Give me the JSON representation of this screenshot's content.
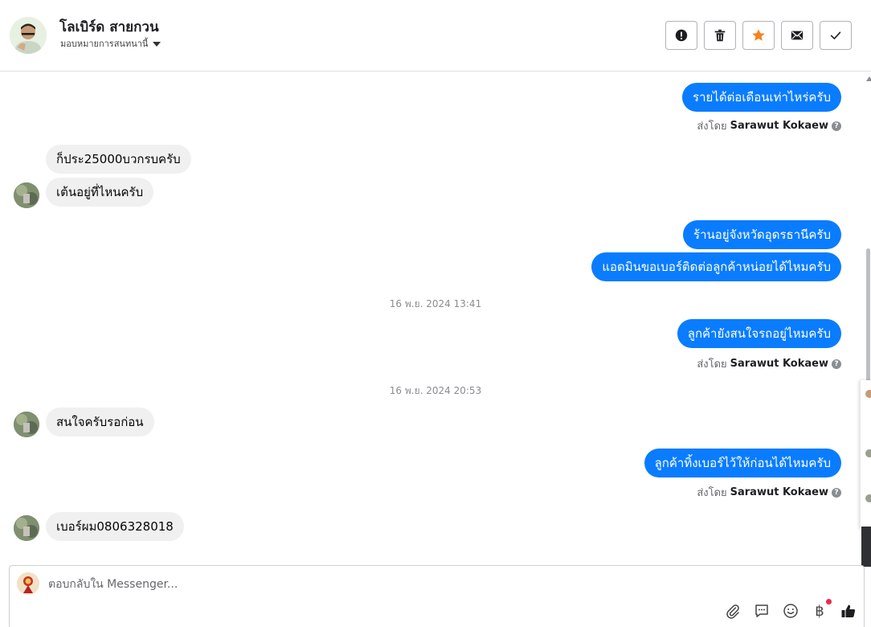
{
  "header": {
    "contact_name": "โลเบิร์ด สายกวน",
    "assign_label": "มอบหมายการสนทนานี้",
    "actions": [
      {
        "name": "spam-button",
        "icon": "alert-circle-icon"
      },
      {
        "name": "delete-button",
        "icon": "trash-icon"
      },
      {
        "name": "star-button",
        "icon": "star-icon"
      },
      {
        "name": "mark-unread-button",
        "icon": "envelope-icon"
      },
      {
        "name": "mark-done-button",
        "icon": "check-icon"
      }
    ]
  },
  "messages": {
    "m1": "รายได้ต่อเดือนเท่าไหร่ครับ",
    "m2": "ก็ประ25000บวกรบครับ",
    "m3": "เต้นอยู่ที่ไหนครับ",
    "m4": "ร้านอยู่จังหวัดอุดรธานีครับ",
    "m5": "แอดมินขอเบอร์ติดต่อลูกค้าหน่อยได้ไหมครับ",
    "m6": "ลูกค้ายังสนใจรถอยู่ไหมครับ",
    "m7": "สนใจครับรอก่อน",
    "m8": "ลูกค้าทิ้งเบอร์ไว้ให้ก่อนได้ไหมครับ",
    "m9": "เบอร์ผม0806328018",
    "sent_by_prefix": "ส่งโดย",
    "sent_by_name": "Sarawut Kokaew",
    "ts1": "16 พ.ย. 2024 13:41",
    "ts2": "16 พ.ย. 2024 20:53"
  },
  "composer": {
    "placeholder": "ตอบกลับใน Messenger...",
    "tools": [
      "attach-icon",
      "saved-reply-icon",
      "emoji-icon",
      "payment-icon",
      "like-icon"
    ],
    "payment_symbol": "฿"
  },
  "colors": {
    "outgoing_bubble": "#0a7cff",
    "incoming_bubble": "#f0f0f0",
    "star": "#f5821f",
    "notification": "#f02849"
  }
}
